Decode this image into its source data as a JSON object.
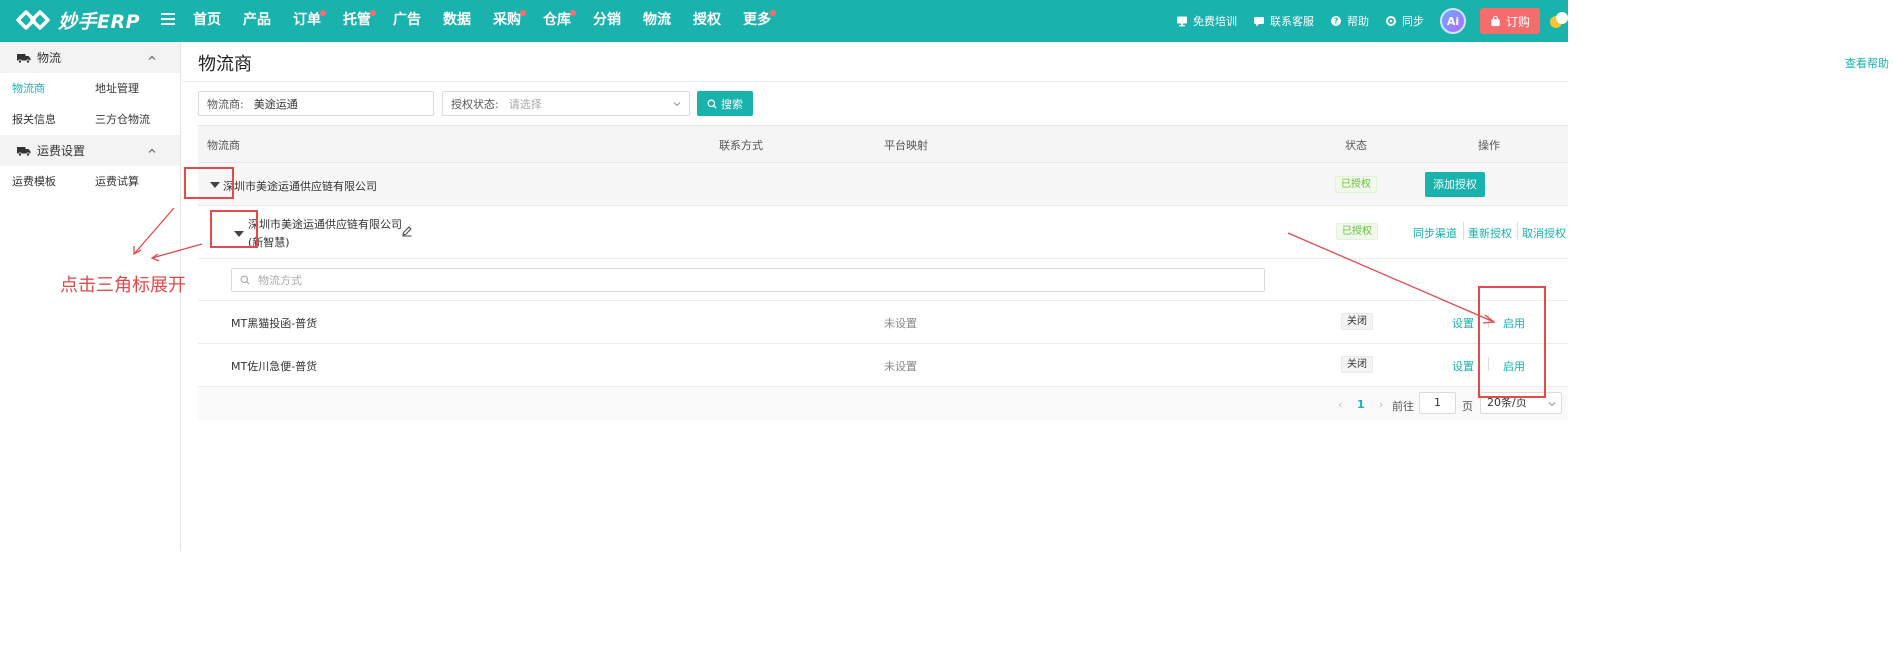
{
  "app": {
    "logo_text": "妙手ERP",
    "nav": [
      {
        "label": "首页",
        "dot": false
      },
      {
        "label": "产品",
        "dot": false
      },
      {
        "label": "订单",
        "dot": true
      },
      {
        "label": "托管",
        "dot": true
      },
      {
        "label": "广告",
        "dot": false
      },
      {
        "label": "数据",
        "dot": false
      },
      {
        "label": "采购",
        "dot": true
      },
      {
        "label": "仓库",
        "dot": true
      },
      {
        "label": "分销",
        "dot": false
      },
      {
        "label": "物流",
        "dot": false
      },
      {
        "label": "授权",
        "dot": false
      },
      {
        "label": "更多",
        "dot": true
      }
    ],
    "top_right": {
      "training": "免费培训",
      "support": "联系客服",
      "help": "帮助",
      "sync": "同步",
      "ai": "Ai",
      "order": "订购"
    }
  },
  "sidebar": {
    "groups": [
      {
        "title": "物流",
        "icon": "truck-icon",
        "links": [
          "物流商",
          "地址管理",
          "报关信息",
          "三方仓物流"
        ],
        "active": "物流商"
      },
      {
        "title": "运费设置",
        "icon": "truck-icon",
        "links": [
          "运费模板",
          "运费试算"
        ]
      }
    ]
  },
  "page": {
    "title": "物流商",
    "help": "查看帮助",
    "filters": {
      "carrier_label": "物流商:",
      "carrier_value": "美途运通",
      "status_label": "授权状态:",
      "status_placeholder": "请选择",
      "search": "搜索"
    },
    "table": {
      "headers": {
        "carrier": "物流商",
        "contact": "联系方式",
        "mapping": "平台映射",
        "status": "状态",
        "actions": "操作"
      },
      "parent_row": {
        "name": "深圳市美途运通供应链有限公司",
        "status": "已授权",
        "action": "添加授权"
      },
      "child_row": {
        "name_line1": "深圳市美途运通供应链有限公司",
        "name_line2": "(新智慧)",
        "status": "已授权",
        "actions": [
          "同步渠道",
          "重新授权",
          "取消授权"
        ]
      },
      "inner_search_placeholder": "物流方式",
      "methods": [
        {
          "name": "MT黑猫投函-普货",
          "mapping": "未设置",
          "status": "关闭",
          "set": "设置",
          "enable": "启用"
        },
        {
          "name": "MT佐川急便-普货",
          "mapping": "未设置",
          "status": "关闭",
          "set": "设置",
          "enable": "启用"
        }
      ]
    },
    "pagination": {
      "current": "1",
      "goto_label": "前往",
      "goto_value": "1",
      "page_unit": "页",
      "page_size": "20条/页"
    }
  },
  "annotation": {
    "text": "点击三角标展开",
    "color": "#e34a4a"
  },
  "colors": {
    "brand": "#19b2ad",
    "success": "#67c23a",
    "danger": "#f46d6d"
  }
}
